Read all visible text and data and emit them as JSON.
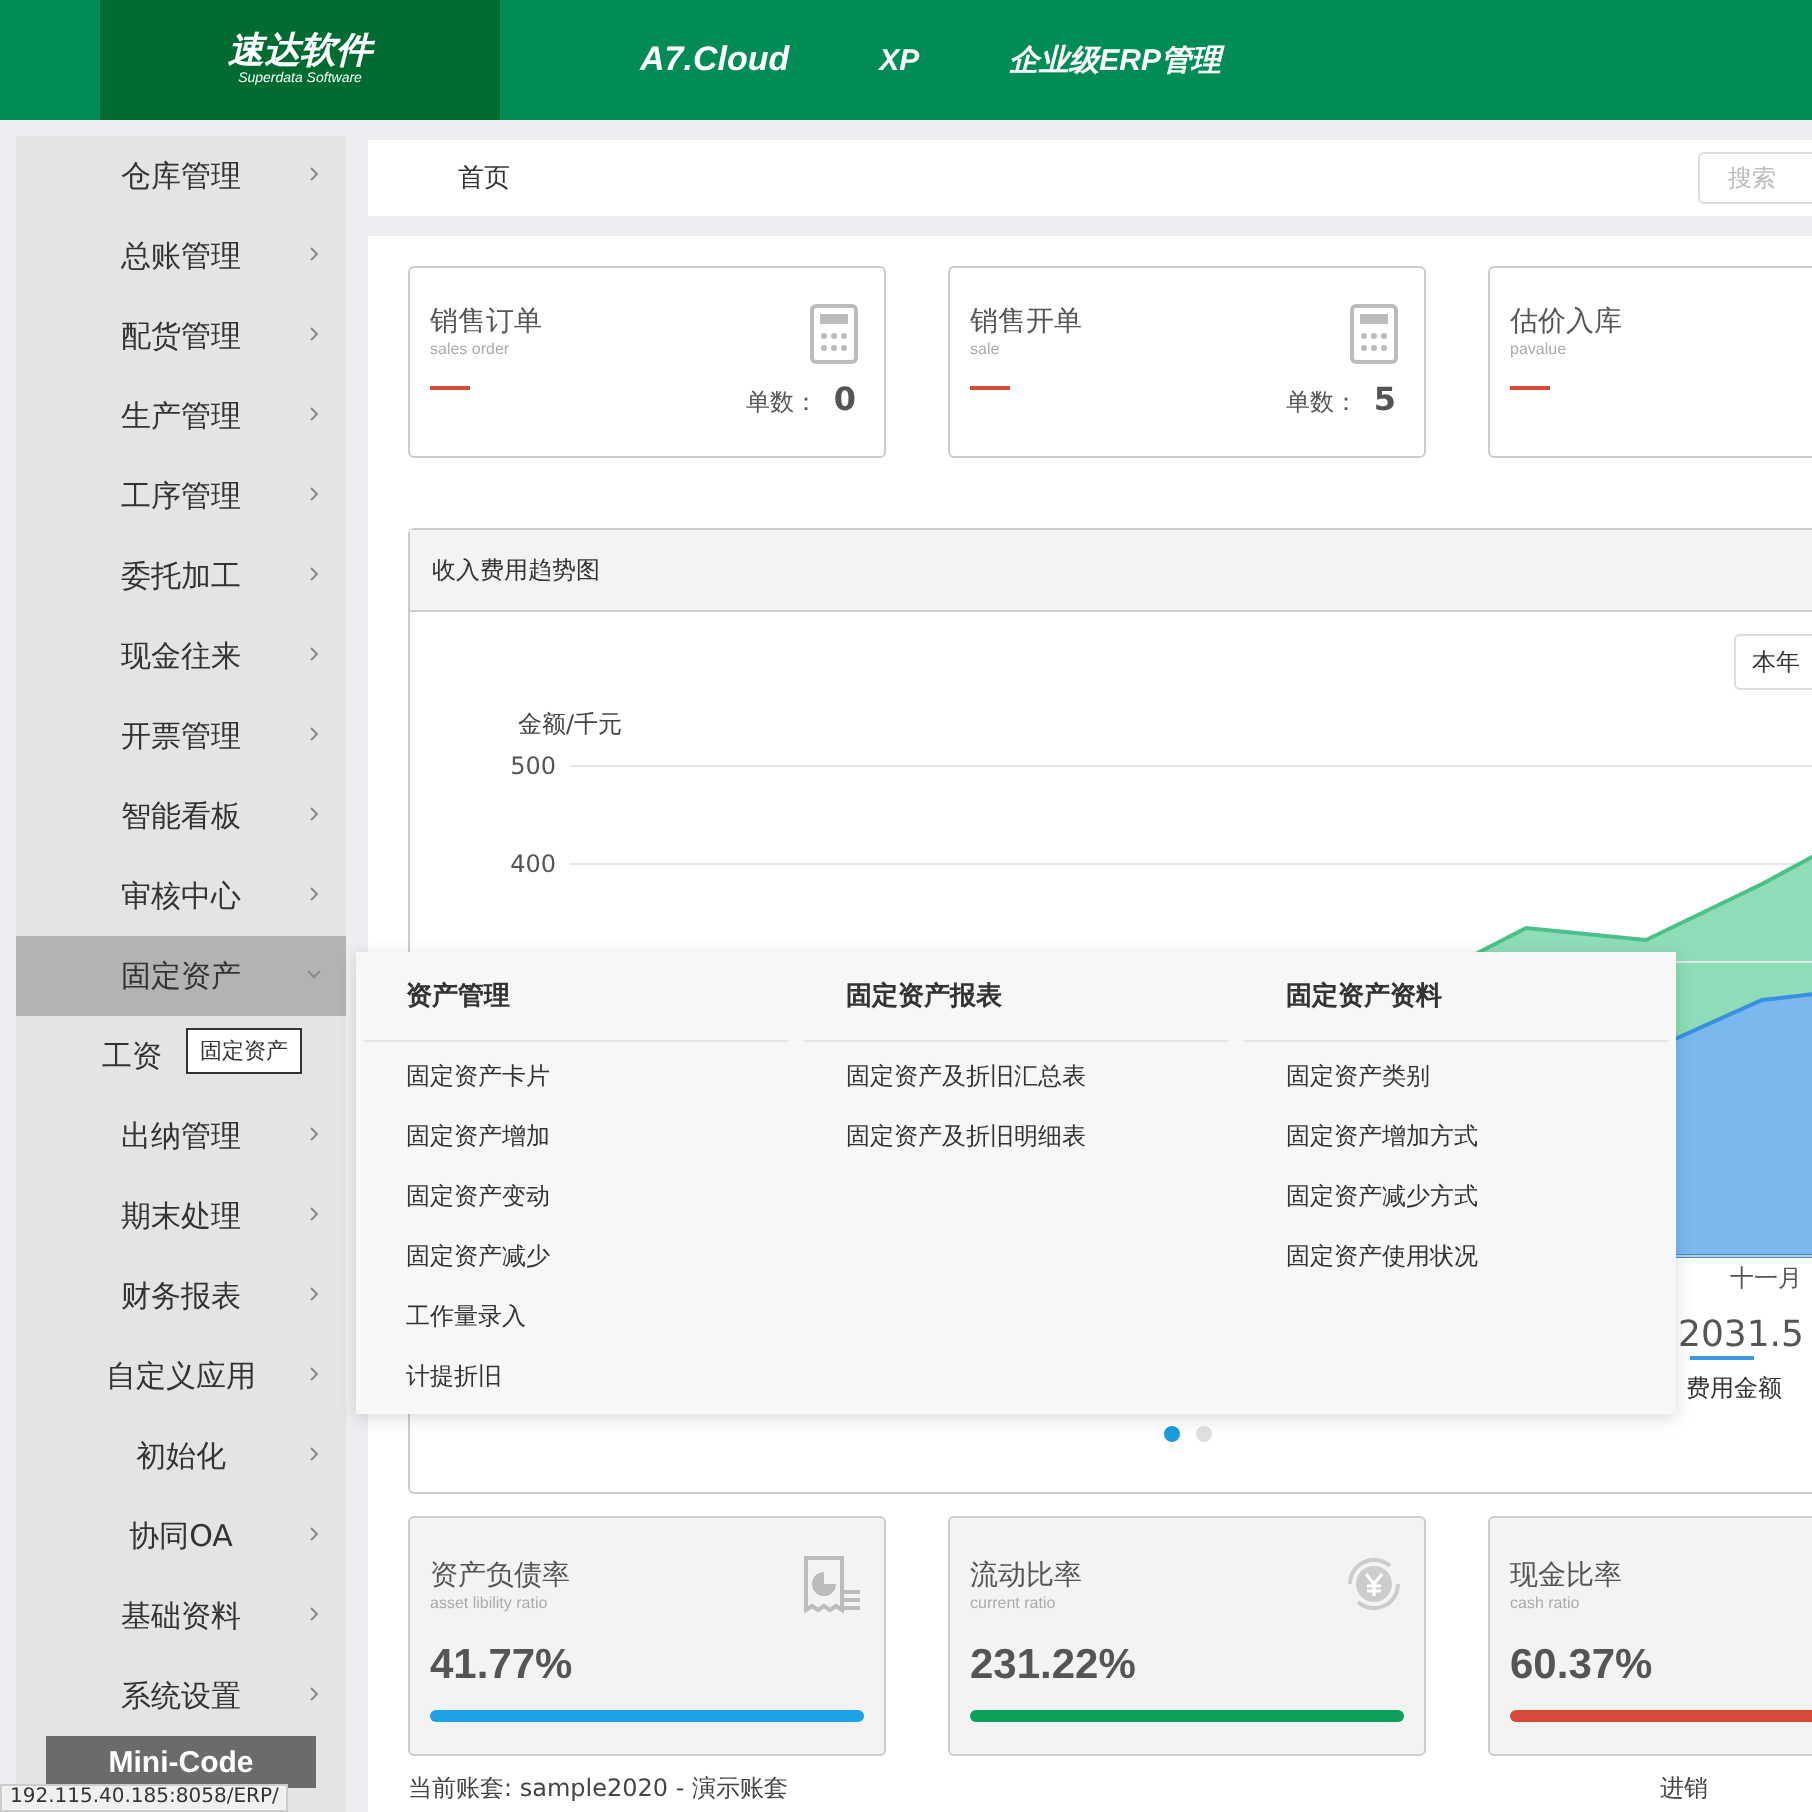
{
  "header": {
    "logo": {
      "name": "速达软件",
      "tagline": "Superdata Software"
    },
    "nav": [
      "A7.Cloud",
      "XP",
      "企业级ERP管理"
    ]
  },
  "sidebar": {
    "items": [
      {
        "label": "仓库管理",
        "selected": false
      },
      {
        "label": "总账管理",
        "selected": false
      },
      {
        "label": "配货管理",
        "selected": false
      },
      {
        "label": "生产管理",
        "selected": false
      },
      {
        "label": "工序管理",
        "selected": false
      },
      {
        "label": "委托加工",
        "selected": false
      },
      {
        "label": "现金往来",
        "selected": false
      },
      {
        "label": "开票管理",
        "selected": false
      },
      {
        "label": "智能看板",
        "selected": false
      },
      {
        "label": "审核中心",
        "selected": false
      },
      {
        "label": "固定资产",
        "selected": true
      },
      {
        "label": "工资",
        "selected": false,
        "truncated": true
      },
      {
        "label": "出纳管理",
        "selected": false
      },
      {
        "label": "期末处理",
        "selected": false
      },
      {
        "label": "财务报表",
        "selected": false
      },
      {
        "label": "自定义应用",
        "selected": false
      },
      {
        "label": "初始化",
        "selected": false
      },
      {
        "label": "协同OA",
        "selected": false
      },
      {
        "label": "基础资料",
        "selected": false
      },
      {
        "label": "系统设置",
        "selected": false
      }
    ],
    "mini_code": "Mini-Code"
  },
  "tooltip": "固定资产",
  "breadcrumb": "首页",
  "search_button": "搜索",
  "stat_cards": [
    {
      "title": "销售订单",
      "subtitle": "sales order",
      "count_label": "单数：",
      "count": "0"
    },
    {
      "title": "销售开单",
      "subtitle": "sale",
      "count_label": "单数：",
      "count": "5"
    },
    {
      "title": "估价入库",
      "subtitle": "pavalue"
    }
  ],
  "chart_panel": {
    "title": "收入费用趋势图",
    "period": "本年",
    "ylabel": "金额/千元",
    "yticks": [
      "500",
      "400"
    ],
    "x_label": "十一月",
    "legend": {
      "value": "2031.5",
      "name": "费用金额"
    },
    "pager_dots": [
      {
        "selected": true
      },
      {
        "selected": false
      }
    ]
  },
  "flyout": {
    "columns": [
      {
        "heading": "资产管理",
        "items": [
          "固定资产卡片",
          "固定资产增加",
          "固定资产变动",
          "固定资产减少",
          "工作量录入",
          "计提折旧"
        ]
      },
      {
        "heading": "固定资产报表",
        "items": [
          "固定资产及折旧汇总表",
          "固定资产及折旧明细表"
        ]
      },
      {
        "heading": "固定资产资料",
        "items": [
          "固定资产类别",
          "固定资产增加方式",
          "固定资产减少方式",
          "固定资产使用状况"
        ]
      }
    ]
  },
  "ratio_cards": [
    {
      "title": "资产负债率",
      "subtitle": "asset libility ratio",
      "value": "41.77%",
      "color": "#1da1e8",
      "kind": "document"
    },
    {
      "title": "流动比率",
      "subtitle": "current ratio",
      "value": "231.22%",
      "color": "#0e9f5a",
      "kind": "currency"
    },
    {
      "title": "现金比率",
      "subtitle": "cash ratio",
      "value": "60.37%",
      "color": "#d9493a",
      "kind": "none"
    }
  ],
  "footer": {
    "account": "当前账套: sample2020 - 演示账套",
    "right": "进销"
  },
  "status_url": "192.115.40.185:8058/ERP/"
}
